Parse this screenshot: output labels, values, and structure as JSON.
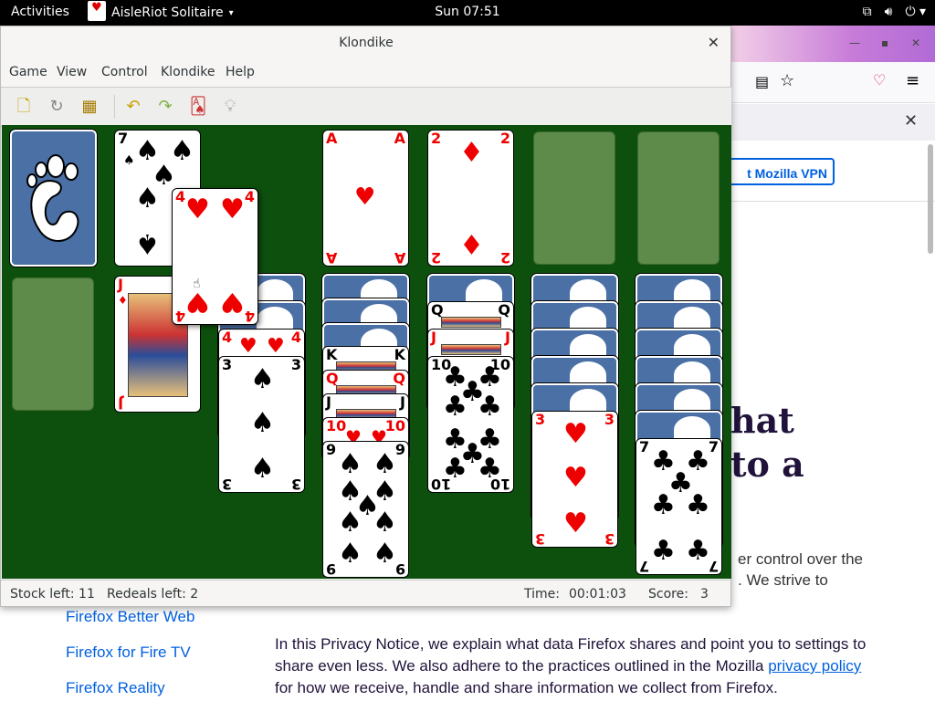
{
  "topbar": {
    "activities": "Activities",
    "app_name": "AisleRiot Solitaire",
    "clock": "Sun 07:51",
    "tray_icons": [
      "network-icon",
      "volume-icon",
      "power-icon"
    ]
  },
  "window": {
    "title": "Klondike",
    "menu": [
      "Game",
      "View",
      "Control",
      "Klondike",
      "Help"
    ],
    "toolbar_icons": [
      "new-game-icon",
      "restart-icon",
      "select-game-icon",
      "undo-icon",
      "redo-icon",
      "deal-icon",
      "hint-icon"
    ]
  },
  "cards": {
    "drag_card": {
      "rank": "4",
      "suit": "♥"
    },
    "waste_card": {
      "rank": "7",
      "suit": "♠"
    },
    "foundation1": {
      "rank": "A",
      "suit": "♥"
    },
    "foundation2": {
      "rank": "2",
      "suit": "♦"
    },
    "t1_top": {
      "rank": "J",
      "suit": "♦"
    },
    "t2_under": {
      "rank": "4",
      "suit": "♥"
    },
    "t2_top": {
      "rank": "3",
      "suit": "♠"
    },
    "t3_k": {
      "rank": "K",
      "suit": "♥"
    },
    "t3_q": {
      "rank": "Q",
      "suit": "♥"
    },
    "t3_j": {
      "rank": "J",
      "suit": "♠"
    },
    "t3_10": {
      "rank": "10",
      "suit": "♥"
    },
    "t3_top": {
      "rank": "9",
      "suit": "♠"
    },
    "t4_q": {
      "rank": "Q",
      "suit": "♠"
    },
    "t4_j": {
      "rank": "J",
      "suit": "♥"
    },
    "t4_top": {
      "rank": "10",
      "suit": "♣"
    },
    "t5_top": {
      "rank": "3",
      "suit": "♥"
    },
    "t6_top": {
      "rank": "7",
      "suit": "♣"
    }
  },
  "status": {
    "stock_left": "Stock left: 11",
    "redeals_left": "Redeals left: 2",
    "time_label": "Time:",
    "time_value": "00:01:03",
    "score_label": "Score:",
    "score_value": "3"
  },
  "firefox": {
    "vpn_button": "t Mozilla VPN",
    "hero_line1": "hat",
    "hero_line2": "to a",
    "body_line1": "er control over the",
    "body_line2": ". We strive to",
    "sidebar_links": [
      "Firefox Better Web",
      "Firefox for Fire TV",
      "Firefox Reality"
    ],
    "para_part1": "In this Privacy Notice, we explain what data Firefox shares and point you to settings to share even less. We also adhere to the practices outlined in the Mozilla ",
    "para_link": "privacy policy",
    "para_part2": " for how we receive, handle and share information we collect from Firefox."
  }
}
